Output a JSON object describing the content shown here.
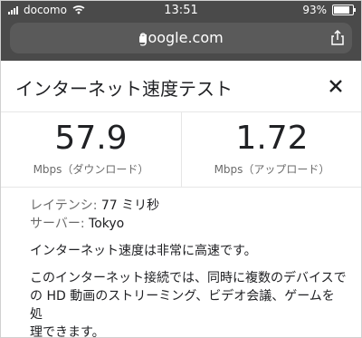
{
  "status": {
    "carrier": "docomo",
    "time": "13:51",
    "battery_text": "93%",
    "battery_level": 0.93
  },
  "browser": {
    "url": "google.com"
  },
  "card": {
    "title": "インターネット速度テスト",
    "download": {
      "value": "57.9",
      "unit": "Mbps（ダウンロード）"
    },
    "upload": {
      "value": "1.72",
      "unit": "Mbps（アップロード）"
    },
    "latency": {
      "label": "レイテンシ:",
      "value": "77 ミリ秒"
    },
    "server": {
      "label": "サーバー:",
      "value": "Tokyo"
    },
    "summary": "インターネット速度は非常に高速です。",
    "detail_line1": "このインターネット接続では、同時に複数のデバイスで",
    "detail_line2": "の HD 動画のストリーミング、ビデオ会議、ゲームを処",
    "detail_line3": "理できます。"
  },
  "icons": {
    "lock": "lock-icon",
    "share": "share-icon",
    "close": "close-icon",
    "wifi": "wifi-icon",
    "signal": "signal-icon",
    "battery": "battery-icon"
  },
  "colors": {
    "chrome_bg": "#4a4a4a",
    "urlbar_bg": "#5a5a5a",
    "text_primary": "#202124",
    "text_secondary": "#6b6b6b",
    "divider": "#e6e6e6"
  }
}
